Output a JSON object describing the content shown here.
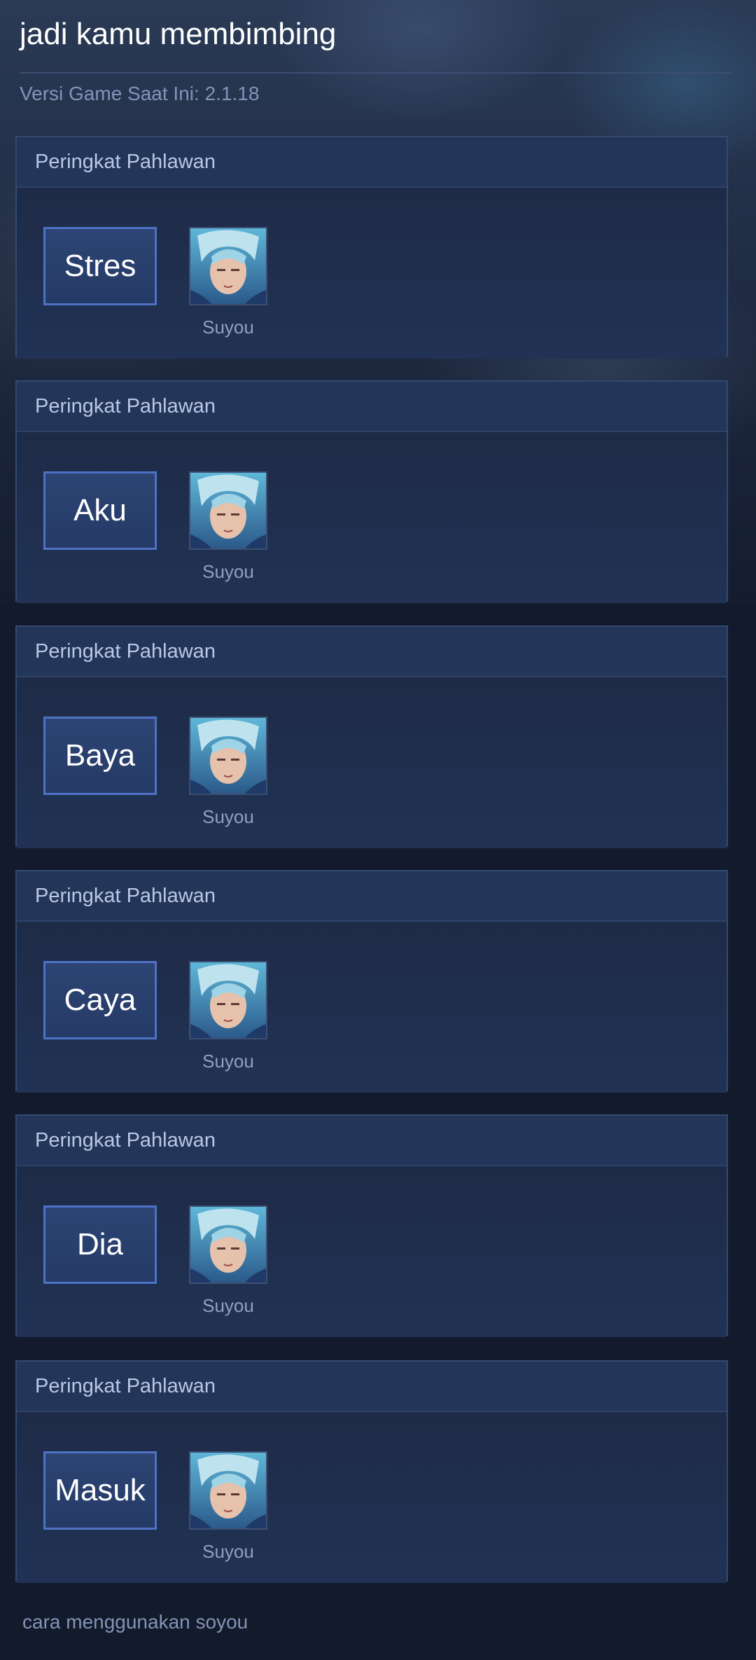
{
  "header": {
    "title": "jadi kamu membimbing",
    "version": "Versi Game Saat Ini: 2.1.18"
  },
  "cards": [
    {
      "title": "Peringkat Pahlawan",
      "rank_label": "Stres",
      "hero_name": "Suyou"
    },
    {
      "title": "Peringkat Pahlawan",
      "rank_label": "Aku",
      "hero_name": "Suyou"
    },
    {
      "title": "Peringkat Pahlawan",
      "rank_label": "Baya",
      "hero_name": "Suyou"
    },
    {
      "title": "Peringkat Pahlawan",
      "rank_label": "Caya",
      "hero_name": "Suyou"
    },
    {
      "title": "Peringkat Pahlawan",
      "rank_label": "Dia",
      "hero_name": "Suyou"
    },
    {
      "title": "Peringkat Pahlawan",
      "rank_label": "Masuk",
      "hero_name": "Suyou"
    }
  ],
  "footer": {
    "text": "cara menggunakan soyou"
  },
  "colors": {
    "background": "#121a2c",
    "card": "#1f2d4a",
    "button_border": "#4e72c4"
  }
}
